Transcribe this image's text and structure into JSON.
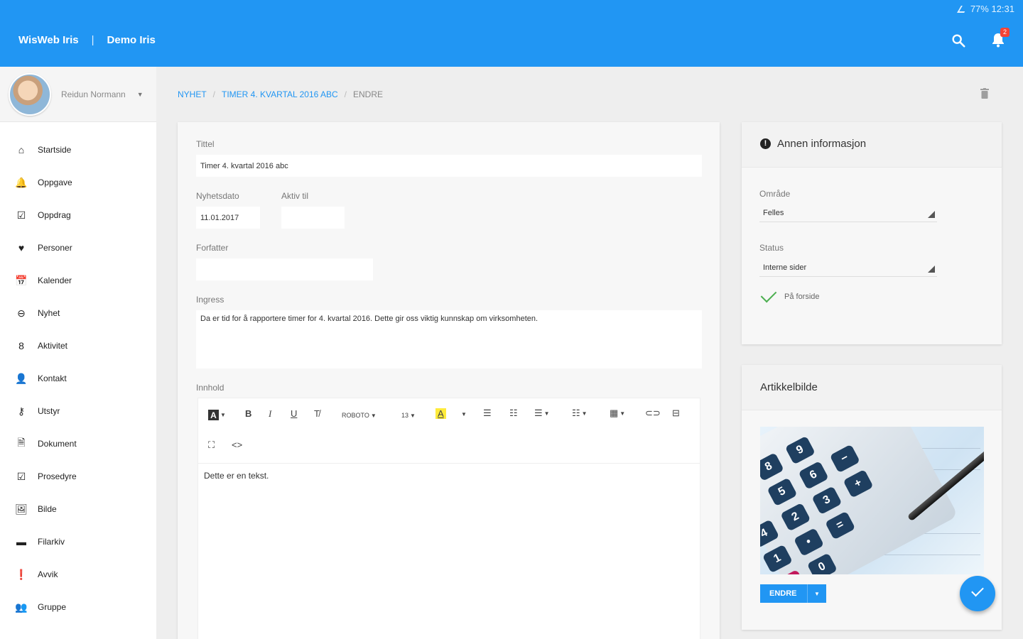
{
  "statusbar": {
    "text": "77% 12:31"
  },
  "appbar": {
    "app_name": "WisWeb Iris",
    "separator": "|",
    "org_name": "Demo Iris",
    "notification_count": "2"
  },
  "user": {
    "name": "Reidun Normann"
  },
  "sidebar": {
    "items": [
      {
        "label": "Startside",
        "icon": "home-icon",
        "glyph": "⌂"
      },
      {
        "label": "Oppgave",
        "icon": "bell-icon",
        "glyph": "🔔"
      },
      {
        "label": "Oppdrag",
        "icon": "checkbox-icon",
        "glyph": "☑"
      },
      {
        "label": "Personer",
        "icon": "heart-icon",
        "glyph": "♥"
      },
      {
        "label": "Kalender",
        "icon": "calendar-icon",
        "glyph": "📅"
      },
      {
        "label": "Nyhet",
        "icon": "news-icon",
        "glyph": "⊖"
      },
      {
        "label": "Aktivitet",
        "icon": "activity-icon",
        "glyph": "8"
      },
      {
        "label": "Kontakt",
        "icon": "person-icon",
        "glyph": "👤"
      },
      {
        "label": "Utstyr",
        "icon": "key-icon",
        "glyph": "⚷"
      },
      {
        "label": "Dokument",
        "icon": "document-icon",
        "glyph": "🗎"
      },
      {
        "label": "Prosedyre",
        "icon": "procedure-icon",
        "glyph": "☑"
      },
      {
        "label": "Bilde",
        "icon": "image-icon",
        "glyph": "🖼"
      },
      {
        "label": "Filarkiv",
        "icon": "folder-icon",
        "glyph": "▬"
      },
      {
        "label": "Avvik",
        "icon": "alert-icon",
        "glyph": "❗"
      },
      {
        "label": "Gruppe",
        "icon": "group-icon",
        "glyph": "👥"
      }
    ]
  },
  "breadcrumb": {
    "items": [
      "NYHET",
      "TIMER 4. KVARTAL 2016 ABC"
    ],
    "current": "ENDRE",
    "separator": "/"
  },
  "form": {
    "title_label": "Tittel",
    "title_value": "Timer 4. kvartal 2016 abc",
    "date_label": "Nyhetsdato",
    "date_value": "11.01.2017",
    "active_label": "Aktiv til",
    "active_value": "",
    "author_label": "Forfatter",
    "author_value": "",
    "ingress_label": "Ingress",
    "ingress_value": "Da er tid for å rapportere timer for 4. kvartal 2016. Dette gir oss viktig kunnskap om virksomheten.",
    "content_label": "Innhold",
    "content_value": "Dette er en tekst."
  },
  "editor_toolbar": {
    "font_name": "ROBOTO",
    "font_size": "13",
    "highlight_letter": "A"
  },
  "info": {
    "heading": "Annen informasjon",
    "area_label": "Område",
    "area_value": "Felles",
    "status_label": "Status",
    "status_value": "Interne sider",
    "frontpage_label": "På forside"
  },
  "image_card": {
    "heading": "Artikkelbilde",
    "edit_button": "ENDRE"
  },
  "colors": {
    "primary": "#2196f3",
    "badge": "#f44336",
    "check": "#4caf50",
    "highlight": "#ffeb3b"
  }
}
